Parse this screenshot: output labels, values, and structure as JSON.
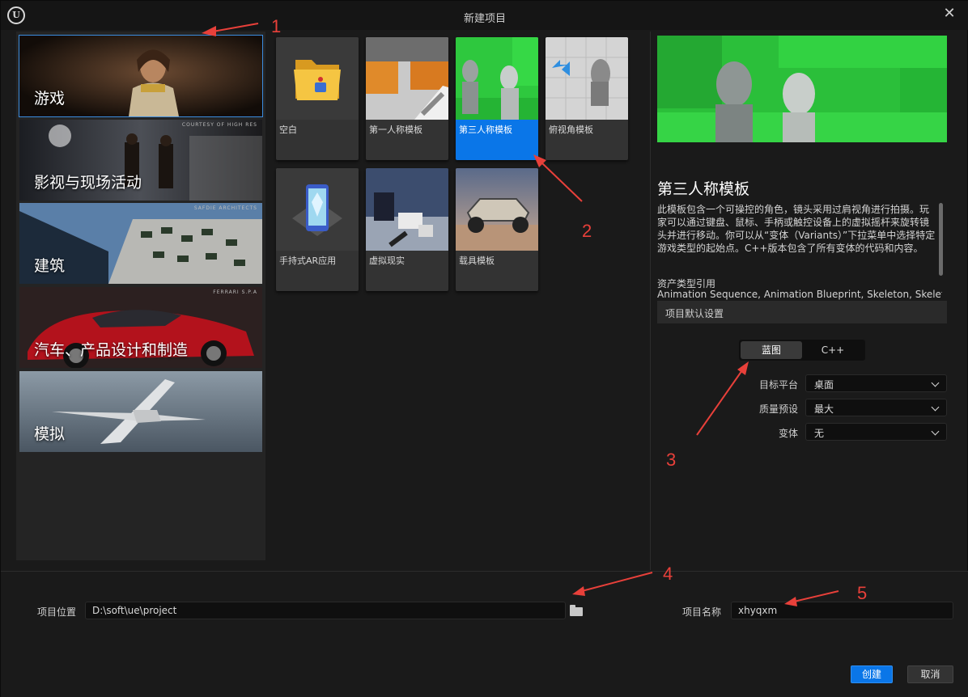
{
  "window": {
    "title": "新建项目"
  },
  "categories": [
    {
      "label": "游戏",
      "credit": ""
    },
    {
      "label": "影视与现场活动",
      "credit": "COURTESY OF HIGH RES"
    },
    {
      "label": "建筑",
      "credit": "SAFDIE ARCHITECTS"
    },
    {
      "label": "汽车、产品设计和制造",
      "credit": "FERRARI S.P.A"
    },
    {
      "label": "模拟",
      "credit": ""
    }
  ],
  "templates": [
    {
      "label": "空白"
    },
    {
      "label": "第一人称模板"
    },
    {
      "label": "第三人称模板"
    },
    {
      "label": "俯视角模板"
    },
    {
      "label": "手持式AR应用"
    },
    {
      "label": "虚拟现实"
    },
    {
      "label": "载具模板"
    }
  ],
  "details": {
    "title": "第三人称模板",
    "description": "此模板包含一个可操控的角色，镜头采用过肩视角进行拍摄。玩家可以通过键盘、鼠标、手柄或触控设备上的虚拟摇杆来旋转镜头并进行移动。你可以从“变体（Variants）”下拉菜单中选择特定游戏类型的起始点。C++版本包含了所有变体的代码和内容。",
    "asset_types_heading": "资产类型引用",
    "asset_types": "Animation Sequence, Animation Blueprint, Skeleton, Skeletal",
    "defaults_heading": "项目默认设置",
    "toggle": {
      "blueprint": "蓝图",
      "cpp": "C++"
    },
    "props": [
      {
        "label": "目标平台",
        "value": "桌面"
      },
      {
        "label": "质量预设",
        "value": "最大"
      },
      {
        "label": "变体",
        "value": "无"
      }
    ]
  },
  "bottom": {
    "location_label": "项目位置",
    "location_value": "D:\\soft\\ue\\project",
    "name_label": "项目名称",
    "name_value": "xhyqxm",
    "create_label": "创建",
    "cancel_label": "取消"
  },
  "annotations": {
    "color": "#e8403a",
    "numbers": [
      "1",
      "2",
      "3",
      "4",
      "5"
    ]
  }
}
